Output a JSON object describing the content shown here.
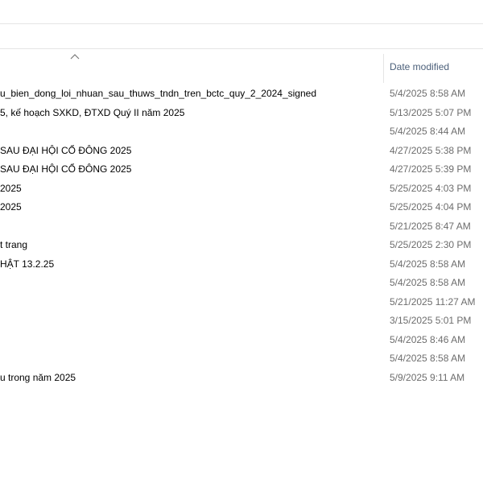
{
  "columns": {
    "date_modified": "Date modified"
  },
  "files": [
    {
      "name": "u_bien_dong_loi_nhuan_sau_thuws_tndn_tren_bctc_quy_2_2024_signed",
      "date": "5/4/2025 8:58 AM"
    },
    {
      "name": "5, kế hoạch SXKD, ĐTXD Quý II năm 2025",
      "date": "5/13/2025 5:07 PM"
    },
    {
      "name": "",
      "date": "5/4/2025 8:44 AM"
    },
    {
      "name": "SAU ĐẠI HỘI CỔ ĐÔNG 2025",
      "date": "4/27/2025 5:38 PM"
    },
    {
      "name": "SAU ĐẠI HỘI CỔ ĐÔNG 2025",
      "date": "4/27/2025 5:39 PM"
    },
    {
      "name": "2025",
      "date": "5/25/2025 4:03 PM"
    },
    {
      "name": "2025",
      "date": "5/25/2025 4:04 PM"
    },
    {
      "name": "",
      "date": "5/21/2025 8:47 AM"
    },
    {
      "name": "t trang",
      "date": "5/25/2025 2:30 PM"
    },
    {
      "name": "HẬT 13.2.25",
      "date": "5/4/2025 8:58 AM"
    },
    {
      "name": "",
      "date": "5/4/2025 8:58 AM"
    },
    {
      "name": "",
      "date": "5/21/2025 11:27 AM"
    },
    {
      "name": "",
      "date": "3/15/2025 5:01 PM"
    },
    {
      "name": "",
      "date": "5/4/2025 8:46 AM"
    },
    {
      "name": "",
      "date": "5/4/2025 8:58 AM"
    },
    {
      "name": "u trong năm 2025",
      "date": "5/9/2025 9:11 AM"
    }
  ]
}
